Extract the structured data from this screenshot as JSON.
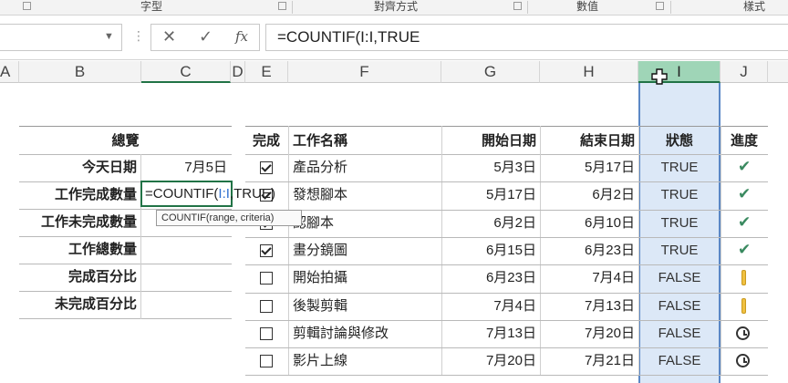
{
  "ribbon": {
    "groups": [
      "字型",
      "對齊方式",
      "數值",
      "樣式"
    ]
  },
  "formula_bar": {
    "name_box_value": "",
    "cancel_icon": "close-icon",
    "enter_icon": "check-icon",
    "fx_label": "fx",
    "formula": "=COUNTIF(I:I,TRUE"
  },
  "columns": [
    "A",
    "B",
    "C",
    "D",
    "E",
    "F",
    "G",
    "H",
    "I",
    "J"
  ],
  "selected_column": "I",
  "summary": {
    "header": "總覽",
    "rows": [
      {
        "label": "今天日期",
        "value": "7月5日"
      },
      {
        "label": "工作完成數量",
        "value": "=COUNTIF(I:I,TRUE)"
      },
      {
        "label": "工作未完成數量",
        "value": ""
      },
      {
        "label": "工作總數量",
        "value": ""
      },
      {
        "label": "完成百分比",
        "value": ""
      },
      {
        "label": "未完成百分比",
        "value": ""
      }
    ]
  },
  "edit_formula_parts": {
    "pre": "=COUNTIF(",
    "ref": "I:I",
    "post": ",TRUE)"
  },
  "tooltip": "COUNTIF(range, criteria)",
  "tasks": {
    "headers": {
      "done": "完成",
      "name": "工作名稱",
      "start": "開始日期",
      "end": "結束日期",
      "status": "狀態",
      "progress": "進度"
    },
    "rows": [
      {
        "done": true,
        "name": "產品分析",
        "start": "5月3日",
        "end": "5月17日",
        "status": "TRUE",
        "progress": "check"
      },
      {
        "done": true,
        "name": "發想腳本",
        "start": "5月17日",
        "end": "6月2日",
        "status": "TRUE",
        "progress": "check"
      },
      {
        "done": true,
        "name": "認腳本",
        "start": "6月2日",
        "end": "6月10日",
        "status": "TRUE",
        "progress": "check"
      },
      {
        "done": true,
        "name": "畫分鏡圖",
        "start": "6月15日",
        "end": "6月23日",
        "status": "TRUE",
        "progress": "check"
      },
      {
        "done": false,
        "name": "開始拍攝",
        "start": "6月23日",
        "end": "7月4日",
        "status": "FALSE",
        "progress": "warning"
      },
      {
        "done": false,
        "name": "後製剪輯",
        "start": "7月4日",
        "end": "7月13日",
        "status": "FALSE",
        "progress": "warning"
      },
      {
        "done": false,
        "name": "剪輯討論與修改",
        "start": "7月13日",
        "end": "7月20日",
        "status": "FALSE",
        "progress": "clock"
      },
      {
        "done": false,
        "name": "影片上線",
        "start": "7月20日",
        "end": "7月21日",
        "status": "FALSE",
        "progress": "clock"
      }
    ]
  },
  "colors": {
    "accent": "#217346",
    "selected_col_header": "#9fd5b7",
    "selected_col_fill": "#dce8f7",
    "ref_blue": "#2e6fd0"
  }
}
